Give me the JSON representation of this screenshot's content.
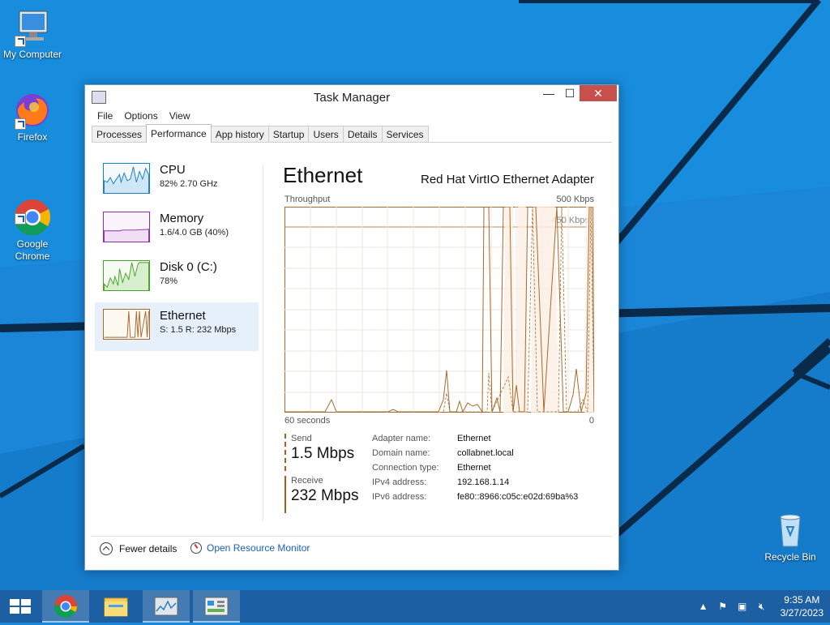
{
  "desktop": {
    "icons": [
      {
        "label": "My Computer"
      },
      {
        "label": "Firefox"
      },
      {
        "label": "Google\nChrome"
      },
      {
        "label": "Recycle Bin"
      }
    ]
  },
  "window": {
    "title": "Task Manager",
    "controls": {
      "minimize": "—",
      "maximize": "☐",
      "close": "✕"
    }
  },
  "menu": [
    "File",
    "Options",
    "View"
  ],
  "tabs": [
    {
      "label": "Processes",
      "active": false
    },
    {
      "label": "Performance",
      "active": true
    },
    {
      "label": "App history",
      "active": false
    },
    {
      "label": "Startup",
      "active": false
    },
    {
      "label": "Users",
      "active": false
    },
    {
      "label": "Details",
      "active": false
    },
    {
      "label": "Services",
      "active": false
    }
  ],
  "perf_list": [
    {
      "name": "CPU",
      "value": "82%  2.70 GHz",
      "color": "#1b7ec2"
    },
    {
      "name": "Memory",
      "value": "1.6/4.0 GB (40%)",
      "color": "#8b2fa8"
    },
    {
      "name": "Disk 0 (C:)",
      "value": "78%",
      "color": "#4aa02c"
    },
    {
      "name": "Ethernet",
      "value": "S: 1.5  R: 232 Mbps",
      "color": "#a76a2a",
      "selected": true
    }
  ],
  "detail": {
    "title": "Ethernet",
    "adapter": "Red Hat VirtIO Ethernet Adapter",
    "throughput_label": "Throughput",
    "throughput_max": "500 Kbps",
    "grid_label": "450 Kbps",
    "axis_left": "60 seconds",
    "axis_right": "0",
    "send_label": "Send",
    "send_value": "1.5 Mbps",
    "receive_label": "Receive",
    "receive_value": "232 Mbps",
    "properties": [
      {
        "label": "Adapter name:",
        "value": "Ethernet"
      },
      {
        "label": "Domain name:",
        "value": "collabnet.local"
      },
      {
        "label": "Connection type:",
        "value": "Ethernet"
      },
      {
        "label": "IPv4 address:",
        "value": "192.168.1.14"
      },
      {
        "label": "IPv6 address:",
        "value": "fe80::8966:c05c:e02d:69ba%3"
      }
    ]
  },
  "footer": {
    "fewer_details": "Fewer details",
    "open_resource_monitor": "Open Resource Monitor"
  },
  "taskbar": {
    "time": "9:35 AM",
    "date": "3/27/2023"
  },
  "colors": {
    "accent_ethernet": "#a76a2a",
    "close_button": "#c7504c",
    "desktop_bg": "#1c86d6",
    "taskbar_bg": "#1d5fa3"
  }
}
